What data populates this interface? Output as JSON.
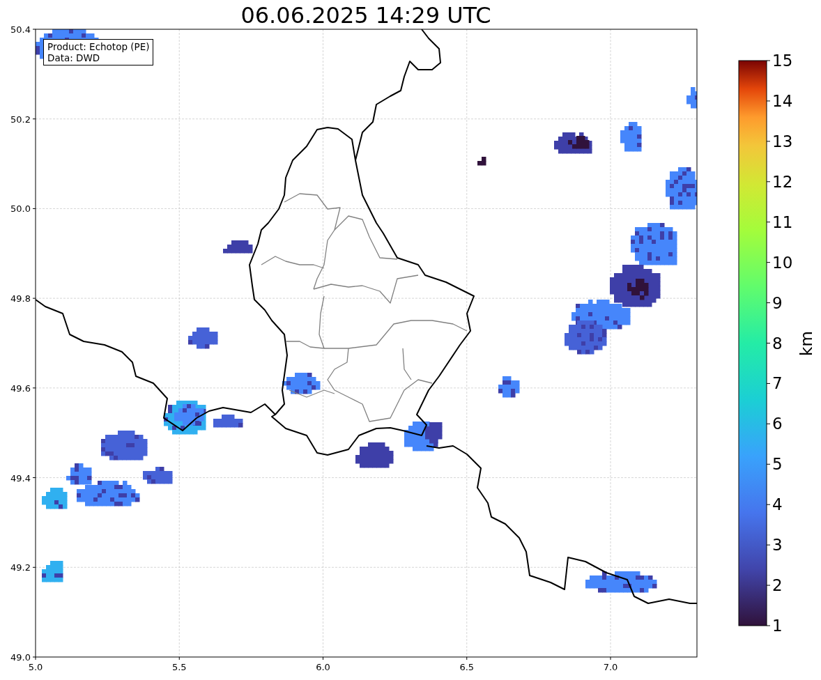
{
  "title": "06.06.2025 14:29 UTC",
  "info_box": {
    "lines": [
      "Product: Echotop (PE)",
      "Data: DWD"
    ]
  },
  "x_ticks": [
    "5.0",
    "5.5",
    "6.0",
    "6.5",
    "7.0"
  ],
  "y_ticks": [
    "50.4",
    "50.2",
    "50.0",
    "49.8",
    "49.6",
    "49.4",
    "49.2",
    "49.0"
  ],
  "colorbar": {
    "label": "km",
    "ticks": [
      "15",
      "14",
      "13",
      "12",
      "11",
      "10",
      "9",
      "8",
      "7",
      "6",
      "5",
      "4",
      "3",
      "2",
      "1"
    ]
  }
}
